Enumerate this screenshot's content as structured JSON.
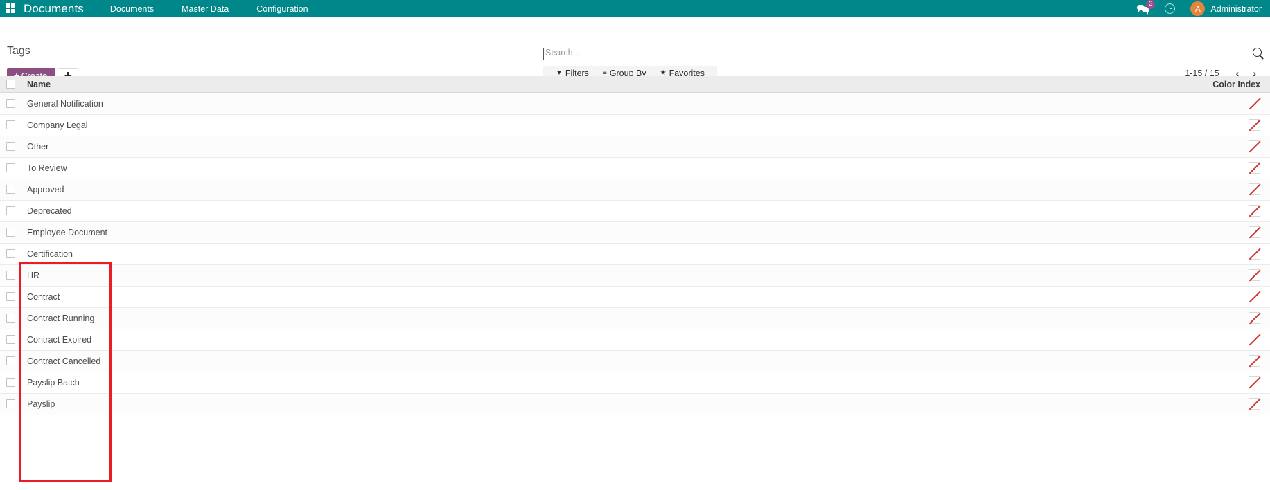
{
  "navbar": {
    "apps_icon": "apps-grid-icon",
    "brand": "Documents",
    "menu": [
      {
        "label": "Documents"
      },
      {
        "label": "Master Data"
      },
      {
        "label": "Configuration"
      }
    ],
    "messages_icon": "chat-bubble-icon",
    "messages_count": "3",
    "activities_icon": "clock-icon",
    "avatar_initial": "A",
    "user_name": "Administrator",
    "bg_color": "#00878A"
  },
  "control_panel": {
    "title": "Tags",
    "create_label": "Create",
    "create_plus": "+",
    "create_color": "#8C4F81",
    "import_icon": "import-download-icon"
  },
  "search": {
    "placeholder": "Search...",
    "value": "",
    "magnifier_icon": "search-icon",
    "facets": [
      {
        "icon": "filter-funnel-icon",
        "glyph": "▼",
        "label": "Filters"
      },
      {
        "icon": "group-by-lines-icon",
        "glyph": "≡",
        "label": "Group By"
      },
      {
        "icon": "favorites-star-icon",
        "glyph": "★",
        "label": "Favorites"
      }
    ],
    "pager": {
      "range": "1-15 / 15",
      "prev_glyph": "‹",
      "next_glyph": "›"
    }
  },
  "table": {
    "columns": [
      {
        "key": "name",
        "label": "Name"
      },
      {
        "key": "color_index",
        "label": "Color Index"
      }
    ],
    "rows": [
      {
        "name": "General Notification",
        "color_index": "no-color"
      },
      {
        "name": "Company Legal",
        "color_index": "no-color"
      },
      {
        "name": "Other",
        "color_index": "no-color"
      },
      {
        "name": "To Review",
        "color_index": "no-color"
      },
      {
        "name": "Approved",
        "color_index": "no-color"
      },
      {
        "name": "Deprecated",
        "color_index": "no-color"
      },
      {
        "name": "Employee Document",
        "color_index": "no-color"
      },
      {
        "name": "Certification",
        "color_index": "no-color"
      },
      {
        "name": "HR",
        "color_index": "no-color"
      },
      {
        "name": "Contract",
        "color_index": "no-color"
      },
      {
        "name": "Contract Running",
        "color_index": "no-color"
      },
      {
        "name": "Contract Expired",
        "color_index": "no-color"
      },
      {
        "name": "Contract Cancelled",
        "color_index": "no-color"
      },
      {
        "name": "Payslip Batch",
        "color_index": "no-color"
      },
      {
        "name": "Payslip",
        "color_index": "no-color"
      }
    ]
  },
  "annotation": {
    "color": "#ec1c24",
    "highlights_rows": [
      "Employee Document",
      "Certification",
      "HR",
      "Contract",
      "Contract Running",
      "Contract Expired",
      "Contract Cancelled",
      "Payslip Batch",
      "Payslip"
    ]
  }
}
